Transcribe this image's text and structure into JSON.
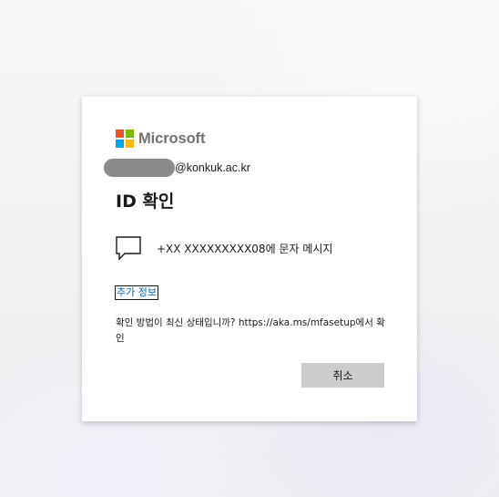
{
  "brand": {
    "name": "Microsoft",
    "colors": [
      "#f25022",
      "#7fba00",
      "#00a4ef",
      "#ffb900"
    ]
  },
  "account": {
    "email_suffix": "@konkuk.ac.kr"
  },
  "title": "ID 확인",
  "verify_option": {
    "icon": "chat-bubble-icon",
    "label": "+XX XXXXXXXXX08에 문자 메시지"
  },
  "more_info_link": "추가 정보",
  "info_text": "확인 방법이 최신 상태입니까? https://aka.ms/mfasetup에서 확인",
  "cancel_button": "취소"
}
